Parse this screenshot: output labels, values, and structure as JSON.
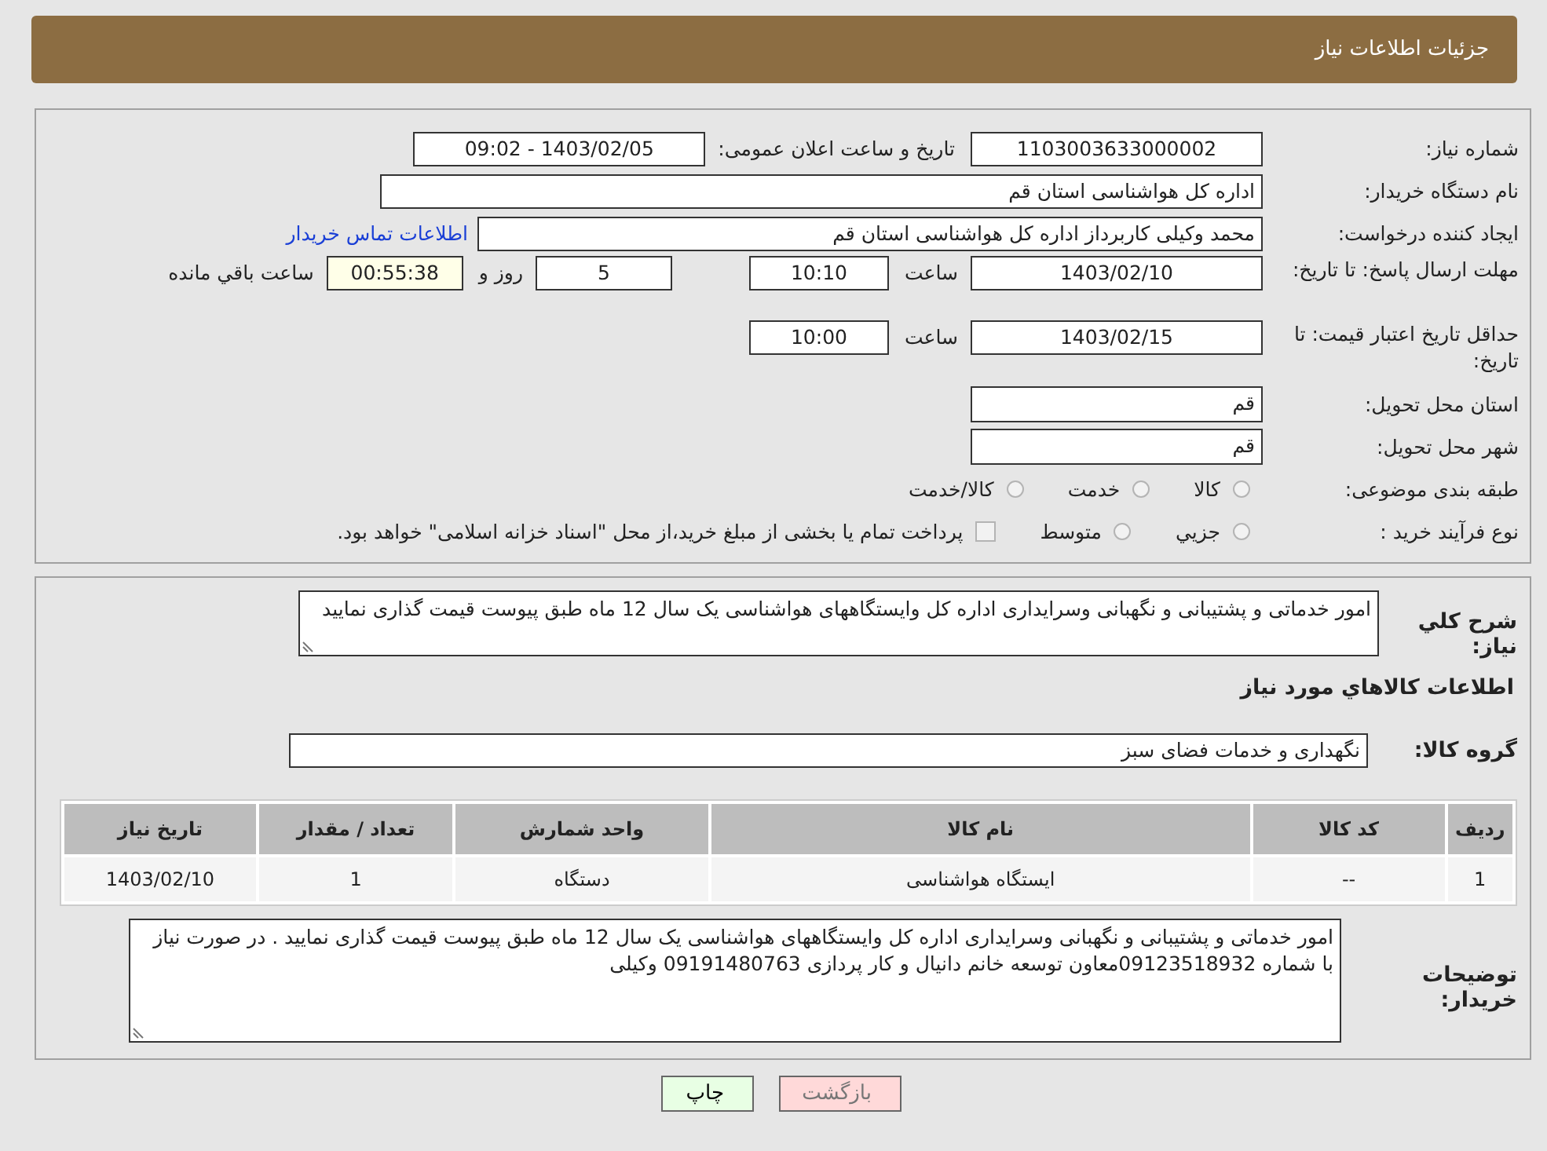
{
  "header": {
    "title": "جزئیات اطلاعات نیاز"
  },
  "info": {
    "need_number": {
      "label": "شماره نیاز:",
      "value": "1103003633000002"
    },
    "announce": {
      "label": "تاریخ و ساعت اعلان عمومی:",
      "value": "1403/02/05 - 09:02"
    },
    "buyer_org": {
      "label": "نام دستگاه خریدار:",
      "value": "اداره کل هواشناسی استان قم"
    },
    "requester": {
      "label": "ایجاد کننده درخواست:",
      "value": "محمد وکیلی کاربرداز اداره کل هواشناسی استان قم",
      "link": "اطلاعات تماس خریدار"
    },
    "response_deadline": {
      "label": "مهلت ارسال پاسخ: تا تاریخ:",
      "date": "1403/02/10",
      "time_label": "ساعت",
      "time": "10:10",
      "days": "5",
      "days_label": "روز و",
      "remaining": "00:55:38",
      "remaining_label": "ساعت باقي مانده"
    },
    "price_validity": {
      "label": "حداقل تاریخ اعتبار قیمت: تا تاریخ:",
      "date": "1403/02/15",
      "time_label": "ساعت",
      "time": "10:00"
    },
    "delivery_province": {
      "label": "استان محل تحویل:",
      "value": "قم"
    },
    "delivery_city": {
      "label": "شهر محل تحویل:",
      "value": "قم"
    },
    "category": {
      "label": "طبقه بندی موضوعی:",
      "options": [
        {
          "label": "کالا",
          "selected": false
        },
        {
          "label": "خدمت",
          "selected": false
        },
        {
          "label": "کالا/خدمت",
          "selected": false
        }
      ]
    },
    "purchase_process": {
      "label": "نوع فرآیند خرید :",
      "options": [
        {
          "label": "جزيي",
          "selected": false
        },
        {
          "label": "متوسط",
          "selected": false
        }
      ],
      "payment_note": {
        "checked": false,
        "text": "پرداخت تمام یا بخشی از مبلغ خرید،از محل \"اسناد خزانه اسلامی\" خواهد بود."
      }
    }
  },
  "details": {
    "description": {
      "label": "شرح کلي نیاز:",
      "value": "امور خدماتی و پشتیبانی و نگهبانی وسرایداری اداره کل وایستگاههای هواشناسی یک سال 12 ماه طبق پیوست قیمت گذاری نمایید"
    },
    "goods_heading": "اطلاعات کالاهاي مورد نیاز",
    "goods_group": {
      "label": "گروه کالا:",
      "value": "نگهداری و خدمات فضای سبز"
    },
    "table": {
      "columns": [
        "ردیف",
        "کد کالا",
        "نام کالا",
        "واحد شمارش",
        "تعداد / مقدار",
        "تاریخ نیاز"
      ],
      "rows": [
        [
          "1",
          "--",
          "ایستگاه هواشناسی",
          "دستگاه",
          "1",
          "1403/02/10"
        ]
      ]
    },
    "buyer_notes": {
      "label": "توضیحات خریدار:",
      "value": "امور خدماتی و پشتیبانی و نگهبانی وسرایداری اداره کل وایستگاههای هواشناسی یک سال 12 ماه طبق پیوست قیمت گذاری نمایید . در صورت نیاز با شماره 09123518932معاون توسعه خانم دانیال و کار پردازی 09191480763 وکیلی"
    }
  },
  "buttons": [
    {
      "label": "بازگشت",
      "kind": "back"
    },
    {
      "label": "چاپ",
      "kind": "print"
    }
  ]
}
